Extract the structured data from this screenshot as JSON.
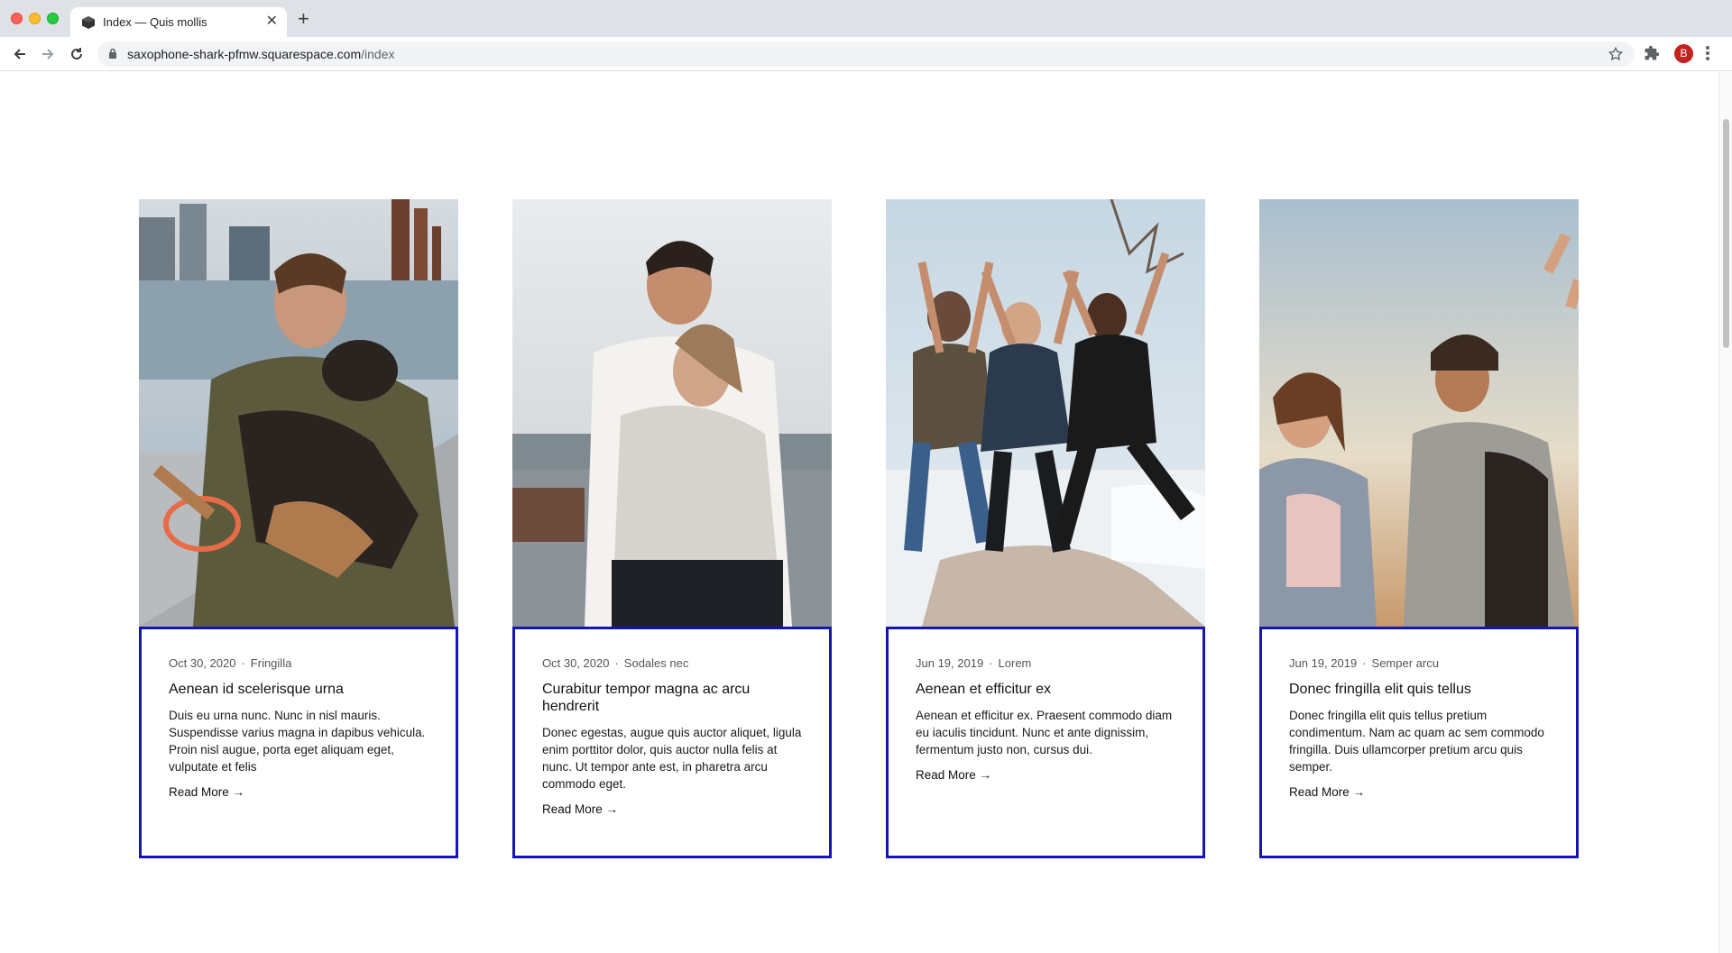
{
  "browser": {
    "tab_title": "Index — Quis mollis",
    "close_glyph": "✕",
    "new_tab_glyph": "+",
    "url_host": "saxophone-shark-pfmw.squarespace.com",
    "url_path": "/index",
    "profile_initial": "B"
  },
  "cards": [
    {
      "date": "Oct 30, 2020",
      "category": "Fringilla",
      "title": "Aenean id scelerisque urna",
      "excerpt": "Duis eu urna nunc. Nunc in nisl mauris. Suspendisse varius magna in dapibus vehicula. Proin nisl augue, porta eget aliquam eget, vulputate et felis",
      "read_more": "Read More →",
      "image_alt": "man kissing dog on pier"
    },
    {
      "date": "Oct 30, 2020",
      "category": "Sodales nec",
      "title": "Curabitur tempor magna ac arcu hendrerit",
      "excerpt": "Donec egestas, augue quis auctor aliquet, ligula enim porttitor dolor, quis auctor nulla felis at nunc. Ut tempor ante est, in pharetra arcu commodo eget.",
      "read_more": "Read More →",
      "image_alt": "couple embracing outdoors"
    },
    {
      "date": "Jun 19, 2019",
      "category": "Lorem",
      "title": "Aenean et efficitur ex",
      "excerpt": "Aenean et efficitur ex. Praesent commodo diam eu iaculis tincidunt. Nunc et ante dignissim, fermentum justo non, cursus dui.",
      "read_more": "Read More →",
      "image_alt": "three friends jumping in snow"
    },
    {
      "date": "Jun 19, 2019",
      "category": "Semper arcu",
      "title": "Donec fringilla elit quis tellus",
      "excerpt": "Donec fringilla elit quis tellus pretium condimentum. Nam ac quam ac sem commodo fringilla. Duis ullamcorper pretium arcu quis semper.",
      "read_more": "Read More →",
      "image_alt": "friends laughing at sunset"
    }
  ],
  "colors": {
    "card_border": "#1515b5"
  }
}
